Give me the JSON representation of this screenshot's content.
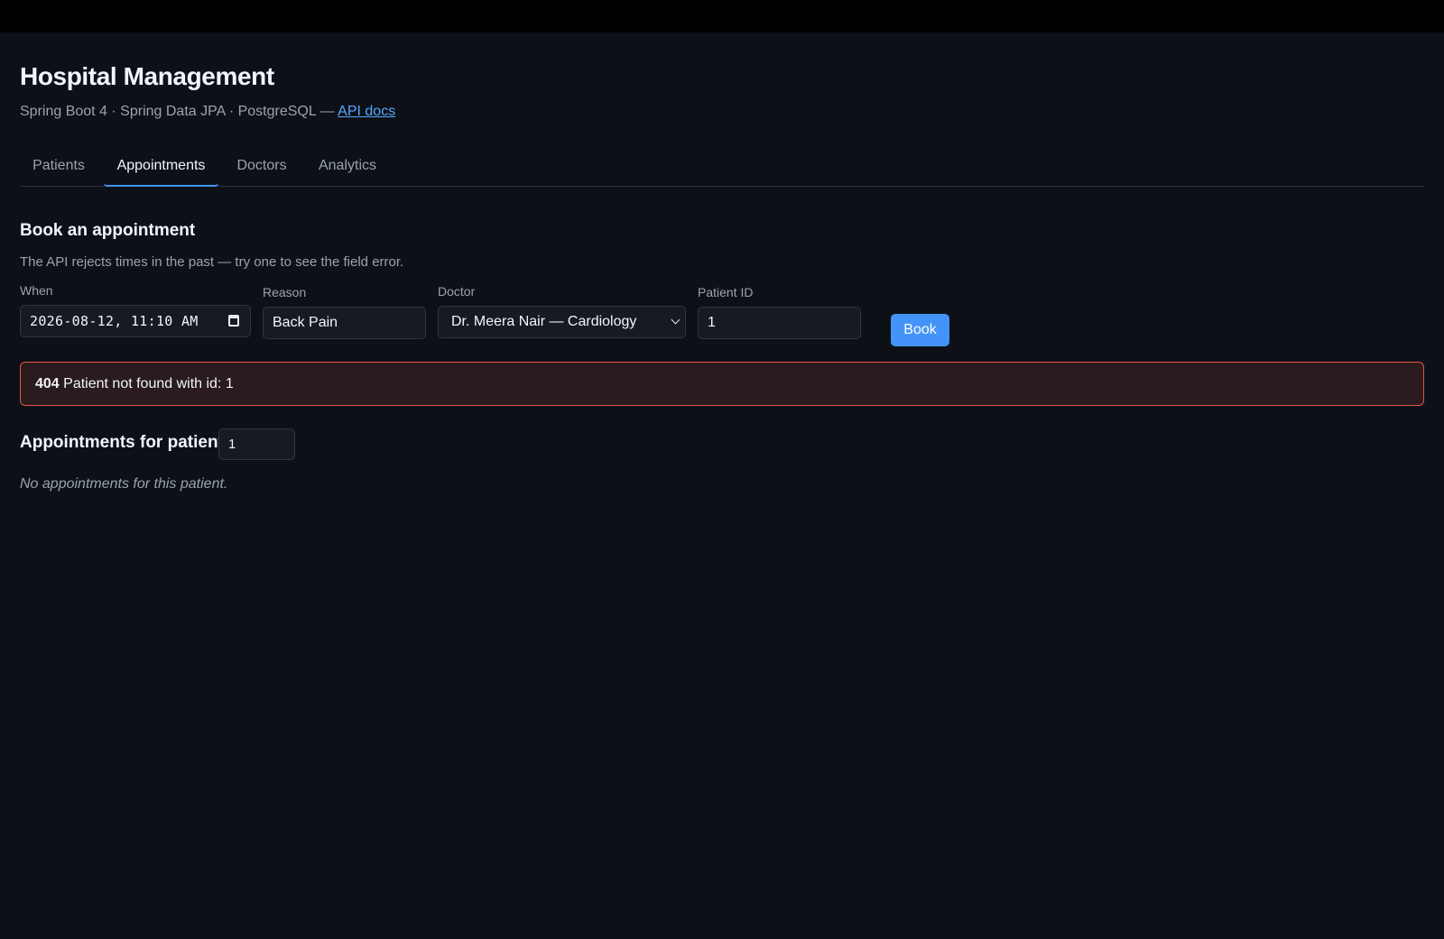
{
  "header": {
    "title": "Hospital Management",
    "subtitle_text": "Spring Boot 4 · Spring Data JPA · PostgreSQL — ",
    "api_docs_link": "API docs"
  },
  "tabs": [
    {
      "label": "Patients",
      "active": false
    },
    {
      "label": "Appointments",
      "active": true
    },
    {
      "label": "Doctors",
      "active": false
    },
    {
      "label": "Analytics",
      "active": false
    }
  ],
  "booking": {
    "title": "Book an appointment",
    "hint": "The API rejects times in the past — try one to see the field error.",
    "when": {
      "label": "When",
      "value": "2026-08-12, 11:10 AM"
    },
    "reason": {
      "label": "Reason",
      "value": "Back Pain"
    },
    "doctor": {
      "label": "Doctor",
      "value": "Dr. Meera Nair — Cardiology"
    },
    "patient_id": {
      "label": "Patient ID",
      "value": "1"
    },
    "book_label": "Book"
  },
  "error": {
    "code": "404",
    "message": "Patient not found with id: 1"
  },
  "appointments": {
    "title": "Appointments for patient",
    "patient_id_value": "1",
    "empty_message": "No appointments for this patient."
  },
  "colors": {
    "background": "#0d1117",
    "accent": "#4493f8",
    "error_border": "#e5534b",
    "error_background": "#2a1b1f"
  }
}
